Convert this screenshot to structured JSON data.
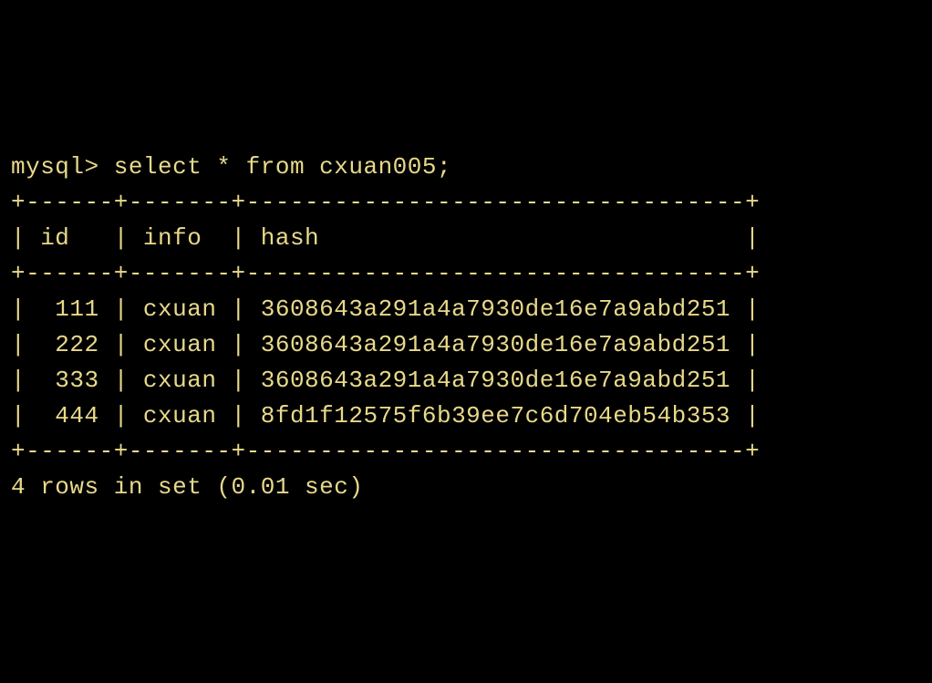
{
  "terminal": {
    "prompt": "mysql> ",
    "command": "select * from cxuan005;",
    "border_top": "+------+-------+----------------------------------+",
    "header_row": "| id   | info  | hash                             |",
    "border_mid": "+------+-------+----------------------------------+",
    "data_rows": [
      "|  111 | cxuan | 3608643a291a4a7930de16e7a9abd251 |",
      "|  222 | cxuan | 3608643a291a4a7930de16e7a9abd251 |",
      "|  333 | cxuan | 3608643a291a4a7930de16e7a9abd251 |",
      "|  444 | cxuan | 8fd1f12575f6b39ee7c6d704eb54b353 |"
    ],
    "border_bottom": "+------+-------+----------------------------------+",
    "footer": "4 rows in set (0.01 sec)"
  },
  "chart_data": {
    "type": "table",
    "title": "cxuan005",
    "columns": [
      "id",
      "info",
      "hash"
    ],
    "rows": [
      {
        "id": 111,
        "info": "cxuan",
        "hash": "3608643a291a4a7930de16e7a9abd251"
      },
      {
        "id": 222,
        "info": "cxuan",
        "hash": "3608643a291a4a7930de16e7a9abd251"
      },
      {
        "id": 333,
        "info": "cxuan",
        "hash": "3608643a291a4a7930de16e7a9abd251"
      },
      {
        "id": 444,
        "info": "cxuan",
        "hash": "8fd1f12575f6b39ee7c6d704eb54b353"
      }
    ],
    "row_count": 4,
    "query_time_sec": 0.01
  }
}
